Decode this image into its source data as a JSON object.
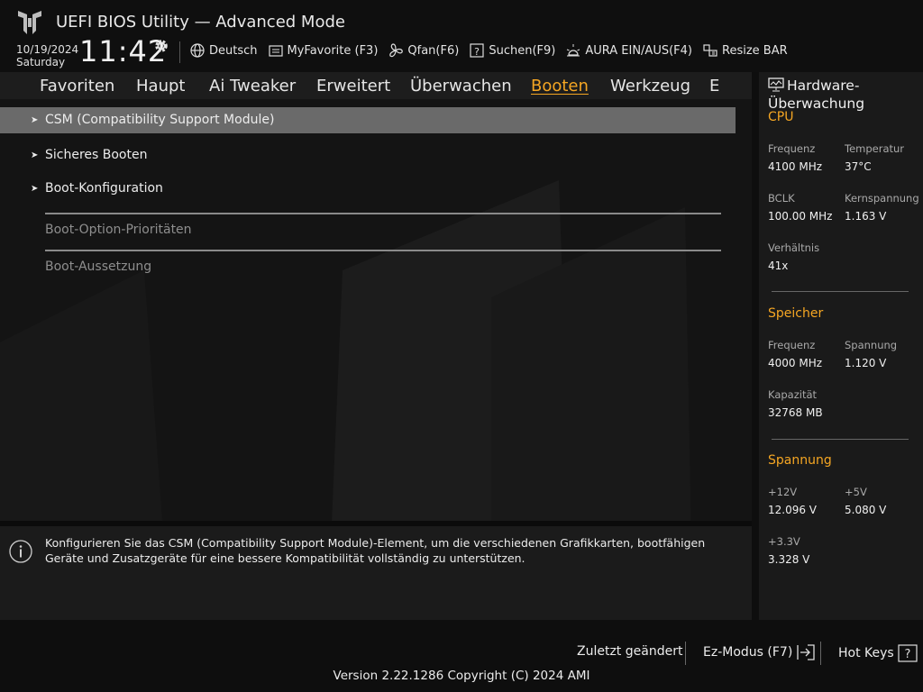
{
  "header": {
    "title": "UEFI BIOS Utility — Advanced Mode",
    "date": "10/19/2024",
    "weekday": "Saturday",
    "time": "11:42"
  },
  "toolbar": {
    "language": "Deutsch",
    "myfavorite": "MyFavorite (F3)",
    "qfan": "Qfan(F6)",
    "search": "Suchen(F9)",
    "aura": "AURA EIN/AUS(F4)",
    "resizebar": "Resize BAR"
  },
  "tabs": [
    {
      "label": "Favoriten"
    },
    {
      "label": "Haupt"
    },
    {
      "label": "Ai Tweaker"
    },
    {
      "label": "Erweitert"
    },
    {
      "label": "Überwachen"
    },
    {
      "label": "Booten"
    },
    {
      "label": "Werkzeug"
    },
    {
      "label": "E"
    }
  ],
  "active_tab": "Booten",
  "menu": {
    "csm": "CSM (Compatibility Support Module)",
    "secure_boot": "Sicheres Booten",
    "boot_config": "Boot-Konfiguration",
    "boot_priorities": "Boot-Option-Prioritäten",
    "boot_override": "Boot-Aussetzung"
  },
  "help": {
    "text": "Konfigurieren Sie das CSM (Compatibility Support Module)-Element, um die verschiedenen Grafikkarten, bootfähigen Geräte und Zusatzgeräte für eine bessere Kompatibilität vollständig zu unterstützen."
  },
  "monitor": {
    "title": "Hardware-Überwachung",
    "cpu": {
      "heading": "CPU",
      "freq_label": "Frequenz",
      "freq_value": "4100 MHz",
      "temp_label": "Temperatur",
      "temp_value": "37°C",
      "bclk_label": "BCLK",
      "bclk_value": "100.00 MHz",
      "vcore_label": "Kernspannung",
      "vcore_value": "1.163 V",
      "ratio_label": "Verhältnis",
      "ratio_value": "41x"
    },
    "memory": {
      "heading": "Speicher",
      "freq_label": "Frequenz",
      "freq_value": "4000 MHz",
      "volt_label": "Spannung",
      "volt_value": "1.120 V",
      "cap_label": "Kapazität",
      "cap_value": "32768 MB"
    },
    "voltage": {
      "heading": "Spannung",
      "v12_label": "+12V",
      "v12_value": "12.096 V",
      "v5_label": "+5V",
      "v5_value": "5.080 V",
      "v33_label": "+3.3V",
      "v33_value": "3.328 V"
    }
  },
  "footer": {
    "last_changed": "Zuletzt geändert",
    "ez_mode": "Ez-Modus (F7)",
    "hot_keys": "Hot Keys",
    "version": "Version 2.22.1286 Copyright (C) 2024 AMI"
  },
  "colors": {
    "accent": "#f5a623",
    "selected_row": "#6a6a6a",
    "background": "#141414"
  }
}
